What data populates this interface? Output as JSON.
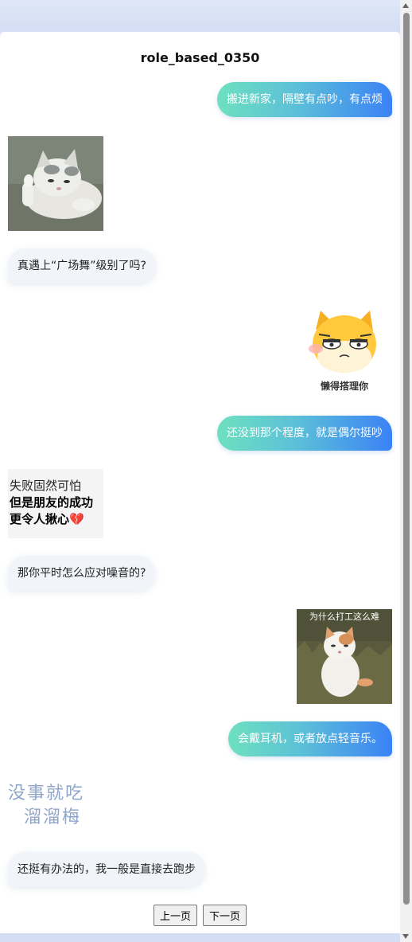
{
  "chat": {
    "title": "role_based_0350",
    "messages": [
      {
        "text": "搬进新家，隔壁有点吵，有点烦"
      },
      {
        "text": "真遇上“广场舞”级别了吗?"
      },
      {
        "text": "还没到那个程度，就是偶尔挺吵"
      },
      {
        "text": "那你平时怎么应对噪音的?"
      },
      {
        "text": "会戴耳机，或者放点轻音乐。"
      },
      {
        "text": "还挺有办法的，我一般是直接去跑步"
      }
    ],
    "stickers": {
      "lazy_cat_caption": "懒得搭理你",
      "failure_line1": "失败固然可怕",
      "failure_line2": "但是朋友的成功",
      "failure_line3": "更令人揪心💔",
      "work_cat_caption": "为什么打工这么难",
      "handwriting_line1": "没事就吃",
      "handwriting_line2": "溜溜梅"
    }
  },
  "pager": {
    "prev_label": "上一页",
    "next_label": "下一页"
  }
}
